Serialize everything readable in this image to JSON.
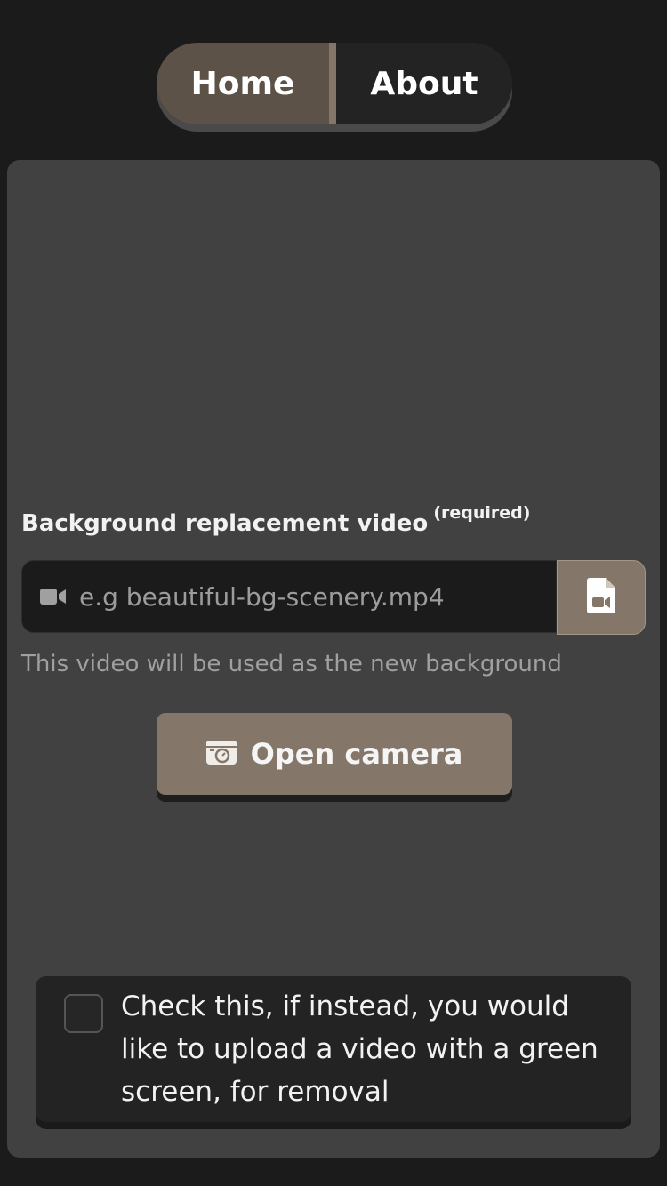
{
  "nav": {
    "home_label": "Home",
    "about_label": "About"
  },
  "form": {
    "field_label": "Background replacement video",
    "required_tag": "(required)",
    "input_placeholder": "e.g beautiful-bg-scenery.mp4",
    "input_value": "",
    "helper_text": "This video will be used as the new background",
    "camera_button_label": "Open camera",
    "green_screen_checkbox_label": "Check this, if instead, you would like to upload a video with a green screen, for removal",
    "green_screen_checked": false
  },
  "icons": {
    "input_icon": "video-camera-icon",
    "file_button_icon": "video-file-icon",
    "camera_button_icon": "camera-icon"
  },
  "colors": {
    "accent": "#84776a",
    "accent_dark": "#5d5247",
    "background": "#1b1b1b",
    "card": "#414141",
    "panel": "#232323"
  }
}
